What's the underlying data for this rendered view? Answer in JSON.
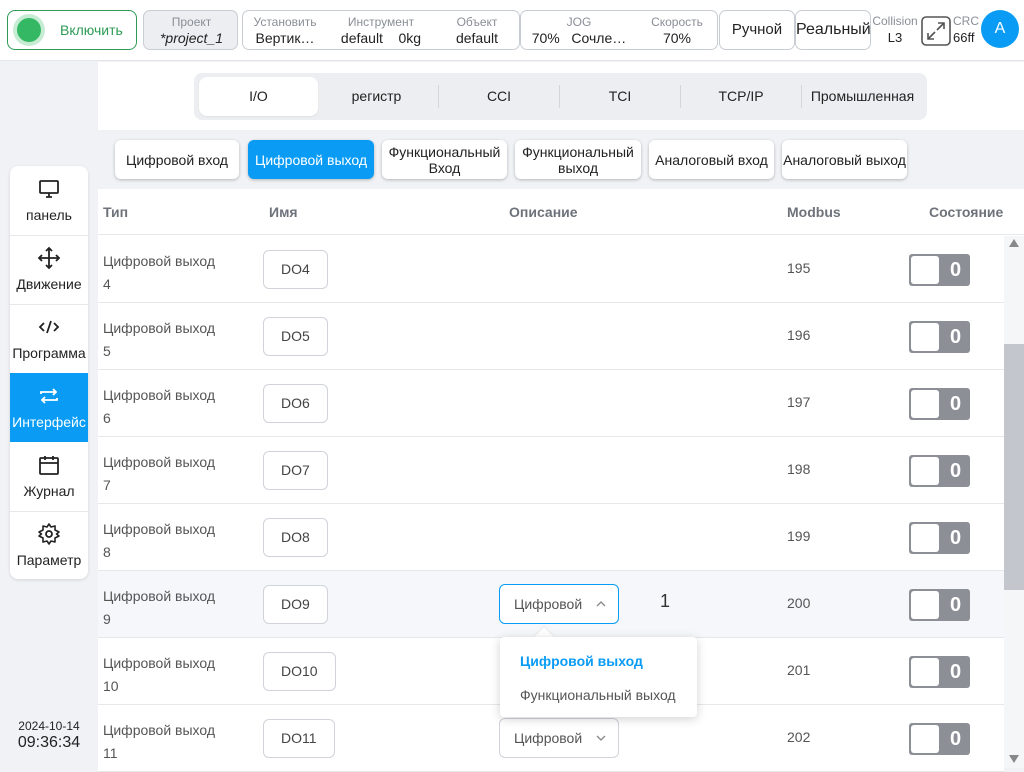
{
  "topbar": {
    "power_label": "Включить",
    "project": {
      "caption": "Проект",
      "value": "*project_1"
    },
    "install": {
      "caption": "Установить",
      "value": "Вертик…"
    },
    "tool": {
      "caption": "Инструмент",
      "value": "default    0kg"
    },
    "object": {
      "caption": "Объект",
      "value": "default"
    },
    "jog": {
      "caption": "JOG",
      "value": "70%   Сочле…"
    },
    "speed": {
      "caption": "Скорость",
      "value": "70%"
    },
    "mode_manual": "Ручной",
    "mode_real": "Реальный",
    "collision": {
      "caption": "Collision",
      "value": "L3"
    },
    "crc": {
      "caption": "CRC",
      "value": "66ff"
    },
    "avatar": "A"
  },
  "sidebar": {
    "items": [
      {
        "label": "панель",
        "icon": "monitor-icon"
      },
      {
        "label": "Движение",
        "icon": "move-icon"
      },
      {
        "label": "Программа",
        "icon": "code-icon"
      },
      {
        "label": "Интерфейс",
        "icon": "swap-icon",
        "active": true
      },
      {
        "label": "Журнал",
        "icon": "calendar-icon"
      },
      {
        "label": "Параметр",
        "icon": "gear-icon"
      }
    ],
    "date": "2024-10-14",
    "time": "09:36:34"
  },
  "tabs": [
    "I/O",
    "регистр",
    "CCI",
    "TCI",
    "TCP/IP",
    "Промышленная"
  ],
  "subtabs": [
    "Цифровой вход",
    "Цифровой выход",
    "Функциональный Вход",
    "Функциональный выход",
    "Аналоговый вход",
    "Аналоговый выход"
  ],
  "table": {
    "headers": {
      "type": "Тип",
      "name": "Имя",
      "desc": "Описание",
      "modbus": "Modbus",
      "state": "Состояние"
    },
    "rows": [
      {
        "type": "Цифровой выход",
        "num": "4",
        "name": "DO4",
        "modbus": "195",
        "state": "0"
      },
      {
        "type": "Цифровой выход",
        "num": "5",
        "name": "DO5",
        "modbus": "196",
        "state": "0"
      },
      {
        "type": "Цифровой выход",
        "num": "6",
        "name": "DO6",
        "modbus": "197",
        "state": "0"
      },
      {
        "type": "Цифровой выход",
        "num": "7",
        "name": "DO7",
        "modbus": "198",
        "state": "0"
      },
      {
        "type": "Цифровой выход",
        "num": "8",
        "name": "DO8",
        "modbus": "199",
        "state": "0"
      },
      {
        "type": "Цифровой выход",
        "num": "9",
        "name": "DO9",
        "modbus": "200",
        "state": "0",
        "desc_select": "Цифровой выход",
        "desc_num": "1"
      },
      {
        "type": "Цифровой выход",
        "num": "10",
        "name": "DO10",
        "modbus": "201",
        "state": "0"
      },
      {
        "type": "Цифровой выход",
        "num": "11",
        "name": "DO11",
        "modbus": "202",
        "state": "0",
        "desc_select": "Цифровой выход"
      }
    ]
  },
  "dropdown": {
    "options": [
      "Цифровой выход",
      "Функциональный выход"
    ],
    "selected": "Цифровой выход"
  },
  "colors": {
    "accent": "#0a9cf5",
    "power": "#34b864",
    "toggle": "#8c8f96"
  }
}
